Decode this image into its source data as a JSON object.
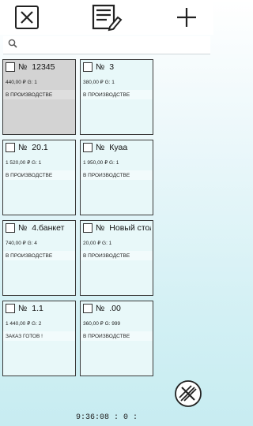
{
  "toolbar": {
    "close_icon": "close-icon",
    "notes_icon": "notes-edit-icon",
    "add_icon": "plus-icon"
  },
  "search": {
    "placeholder": "",
    "value": "",
    "icon": "search-icon"
  },
  "orders": [
    {
      "number": "12345",
      "price": "440,00 ₽ G: 1",
      "status": "В ПРОИЗВОДСТВЕ"
    },
    {
      "number": "3",
      "price": "380,00 ₽ G: 1",
      "status": "В ПРОИЗВОДСТВЕ"
    },
    {
      "number": "20.1",
      "price": "1 520,00 ₽ G: 1",
      "status": "В ПРОИЗВОДСТВЕ"
    },
    {
      "number": "Куаа",
      "price": "1 950,00 ₽ G: 1",
      "status": "В ПРОИЗВОДСТВЕ"
    },
    {
      "number": "4.банкет",
      "price": "740,00 ₽ G: 4",
      "status": "В ПРОИЗВОДСТВЕ"
    },
    {
      "number": "Новый стол",
      "price": "20,00 ₽ G: 1",
      "status": "В ПРОИЗВОДСТВЕ"
    },
    {
      "number": "1.1",
      "price": "1 440,00 ₽ G: 2",
      "status": "ЗАКАЗ ГОТОВ !"
    },
    {
      "number": ".00",
      "price": "360,00 ₽ G: 999",
      "status": "В ПРОИЗВОДСТВЕ"
    }
  ],
  "order_prefix": "№",
  "clock": "9:36:08 : 0 :",
  "fab_icon": "cutlery-cross-icon"
}
